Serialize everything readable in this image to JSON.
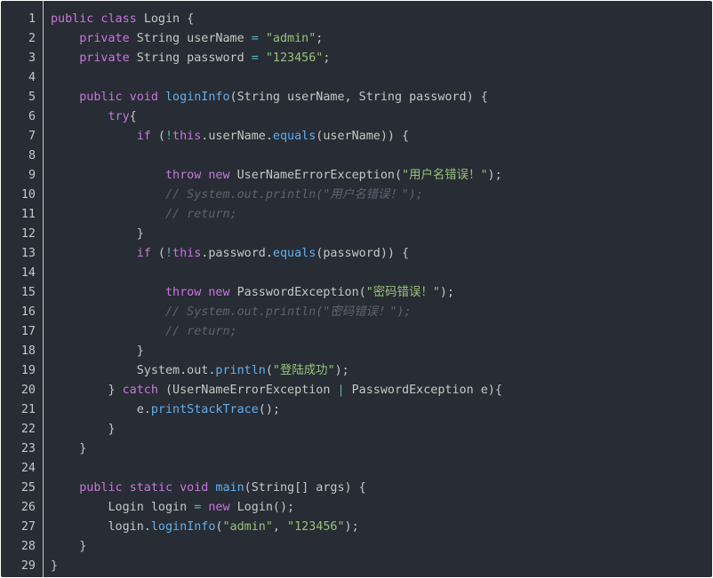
{
  "lines": [
    {
      "n": "1",
      "indent": 0,
      "tokens": [
        {
          "t": "public class ",
          "c": "kw"
        },
        {
          "t": "Login {",
          "c": "plain"
        }
      ]
    },
    {
      "n": "2",
      "indent": 4,
      "tokens": [
        {
          "t": "private ",
          "c": "kw"
        },
        {
          "t": "String userName ",
          "c": "plain"
        },
        {
          "t": "=",
          "c": "op"
        },
        {
          "t": " ",
          "c": "plain"
        },
        {
          "t": "\"admin\"",
          "c": "str"
        },
        {
          "t": ";",
          "c": "plain"
        }
      ]
    },
    {
      "n": "3",
      "indent": 4,
      "tokens": [
        {
          "t": "private ",
          "c": "kw"
        },
        {
          "t": "String password ",
          "c": "plain"
        },
        {
          "t": "=",
          "c": "op"
        },
        {
          "t": " ",
          "c": "plain"
        },
        {
          "t": "\"123456\"",
          "c": "str"
        },
        {
          "t": ";",
          "c": "plain"
        }
      ]
    },
    {
      "n": "4",
      "indent": 0,
      "tokens": []
    },
    {
      "n": "5",
      "indent": 4,
      "tokens": [
        {
          "t": "public void ",
          "c": "kw"
        },
        {
          "t": "loginInfo",
          "c": "fn"
        },
        {
          "t": "(String userName, String password) {",
          "c": "plain"
        }
      ]
    },
    {
      "n": "6",
      "indent": 8,
      "tokens": [
        {
          "t": "try",
          "c": "kw"
        },
        {
          "t": "{",
          "c": "plain"
        }
      ]
    },
    {
      "n": "7",
      "indent": 12,
      "tokens": [
        {
          "t": "if ",
          "c": "kw"
        },
        {
          "t": "(",
          "c": "plain"
        },
        {
          "t": "!",
          "c": "op"
        },
        {
          "t": "this",
          "c": "kw"
        },
        {
          "t": ".userName.",
          "c": "plain"
        },
        {
          "t": "equals",
          "c": "fn"
        },
        {
          "t": "(userName)) {",
          "c": "plain"
        }
      ]
    },
    {
      "n": "8",
      "indent": 0,
      "tokens": []
    },
    {
      "n": "9",
      "indent": 16,
      "tokens": [
        {
          "t": "throw new ",
          "c": "kw"
        },
        {
          "t": "UserNameErrorException(",
          "c": "plain"
        },
        {
          "t": "\"用户名错误！\"",
          "c": "str"
        },
        {
          "t": ");",
          "c": "plain"
        }
      ]
    },
    {
      "n": "10",
      "indent": 16,
      "tokens": [
        {
          "t": "// System.out.println(\"用户名错误！\");",
          "c": "com"
        }
      ]
    },
    {
      "n": "11",
      "indent": 16,
      "tokens": [
        {
          "t": "// return;",
          "c": "com"
        }
      ]
    },
    {
      "n": "12",
      "indent": 12,
      "tokens": [
        {
          "t": "}",
          "c": "plain"
        }
      ]
    },
    {
      "n": "13",
      "indent": 12,
      "tokens": [
        {
          "t": "if ",
          "c": "kw"
        },
        {
          "t": "(",
          "c": "plain"
        },
        {
          "t": "!",
          "c": "op"
        },
        {
          "t": "this",
          "c": "kw"
        },
        {
          "t": ".password.",
          "c": "plain"
        },
        {
          "t": "equals",
          "c": "fn"
        },
        {
          "t": "(password)) {",
          "c": "plain"
        }
      ]
    },
    {
      "n": "14",
      "indent": 0,
      "tokens": []
    },
    {
      "n": "15",
      "indent": 16,
      "tokens": [
        {
          "t": "throw new ",
          "c": "kw"
        },
        {
          "t": "PasswordException(",
          "c": "plain"
        },
        {
          "t": "\"密码错误！\"",
          "c": "str"
        },
        {
          "t": ");",
          "c": "plain"
        }
      ]
    },
    {
      "n": "16",
      "indent": 16,
      "tokens": [
        {
          "t": "// System.out.println(\"密码错误！\");",
          "c": "com"
        }
      ]
    },
    {
      "n": "17",
      "indent": 16,
      "tokens": [
        {
          "t": "// return;",
          "c": "com"
        }
      ]
    },
    {
      "n": "18",
      "indent": 12,
      "tokens": [
        {
          "t": "}",
          "c": "plain"
        }
      ]
    },
    {
      "n": "19",
      "indent": 12,
      "tokens": [
        {
          "t": "System.out.",
          "c": "plain"
        },
        {
          "t": "println",
          "c": "fn"
        },
        {
          "t": "(",
          "c": "plain"
        },
        {
          "t": "\"登陆成功\"",
          "c": "str"
        },
        {
          "t": ");",
          "c": "plain"
        }
      ]
    },
    {
      "n": "20",
      "indent": 8,
      "tokens": [
        {
          "t": "} ",
          "c": "plain"
        },
        {
          "t": "catch ",
          "c": "kw"
        },
        {
          "t": "(UserNameErrorException ",
          "c": "plain"
        },
        {
          "t": "|",
          "c": "op"
        },
        {
          "t": " PasswordException e){",
          "c": "plain"
        }
      ]
    },
    {
      "n": "21",
      "indent": 12,
      "tokens": [
        {
          "t": "e.",
          "c": "plain"
        },
        {
          "t": "printStackTrace",
          "c": "fn"
        },
        {
          "t": "();",
          "c": "plain"
        }
      ]
    },
    {
      "n": "22",
      "indent": 8,
      "tokens": [
        {
          "t": "}",
          "c": "plain"
        }
      ]
    },
    {
      "n": "23",
      "indent": 4,
      "tokens": [
        {
          "t": "}",
          "c": "plain"
        }
      ]
    },
    {
      "n": "24",
      "indent": 0,
      "tokens": []
    },
    {
      "n": "25",
      "indent": 4,
      "tokens": [
        {
          "t": "public static void ",
          "c": "kw"
        },
        {
          "t": "main",
          "c": "fn"
        },
        {
          "t": "(String[] args) {",
          "c": "plain"
        }
      ]
    },
    {
      "n": "26",
      "indent": 8,
      "tokens": [
        {
          "t": "Login login ",
          "c": "plain"
        },
        {
          "t": "=",
          "c": "op"
        },
        {
          "t": " ",
          "c": "plain"
        },
        {
          "t": "new ",
          "c": "kw"
        },
        {
          "t": "Login();",
          "c": "plain"
        }
      ]
    },
    {
      "n": "27",
      "indent": 8,
      "tokens": [
        {
          "t": "login.",
          "c": "plain"
        },
        {
          "t": "loginInfo",
          "c": "fn"
        },
        {
          "t": "(",
          "c": "plain"
        },
        {
          "t": "\"admin\"",
          "c": "str"
        },
        {
          "t": ", ",
          "c": "plain"
        },
        {
          "t": "\"123456\"",
          "c": "str"
        },
        {
          "t": ");",
          "c": "plain"
        }
      ]
    },
    {
      "n": "28",
      "indent": 4,
      "tokens": [
        {
          "t": "}",
          "c": "plain"
        }
      ]
    },
    {
      "n": "29",
      "indent": 0,
      "tokens": [
        {
          "t": "}",
          "c": "plain"
        }
      ]
    }
  ]
}
